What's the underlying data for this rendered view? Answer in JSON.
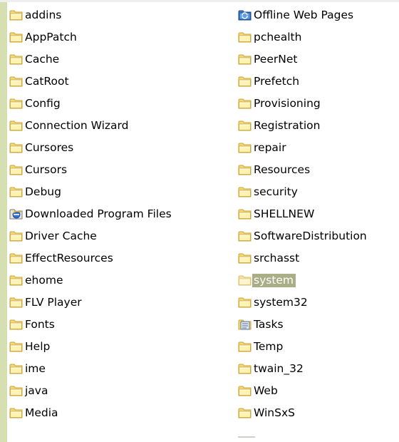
{
  "window": {
    "accent_strip_color": "#d6dfb2",
    "selection_color": "#a9ae86",
    "folder_color": "#f5d774"
  },
  "left_column": [
    {
      "label": "addins",
      "icon": "folder-icon"
    },
    {
      "label": "AppPatch",
      "icon": "folder-icon"
    },
    {
      "label": "Cache",
      "icon": "folder-icon"
    },
    {
      "label": "CatRoot",
      "icon": "folder-icon"
    },
    {
      "label": "Config",
      "icon": "folder-icon"
    },
    {
      "label": "Connection Wizard",
      "icon": "folder-icon"
    },
    {
      "label": "Cursores",
      "icon": "folder-icon"
    },
    {
      "label": "Cursors",
      "icon": "folder-icon"
    },
    {
      "label": "Debug",
      "icon": "folder-icon"
    },
    {
      "label": "Downloaded Program Files",
      "icon": "ie-folder-icon"
    },
    {
      "label": "Driver Cache",
      "icon": "folder-icon"
    },
    {
      "label": "EffectResources",
      "icon": "folder-icon"
    },
    {
      "label": "ehome",
      "icon": "folder-icon"
    },
    {
      "label": "FLV Player",
      "icon": "folder-icon"
    },
    {
      "label": "Fonts",
      "icon": "folder-icon"
    },
    {
      "label": "Help",
      "icon": "folder-icon"
    },
    {
      "label": "ime",
      "icon": "folder-icon"
    },
    {
      "label": "java",
      "icon": "folder-icon"
    },
    {
      "label": "Media",
      "icon": "folder-icon"
    }
  ],
  "right_column": [
    {
      "label": "Offline Web Pages",
      "icon": "offline-pages-icon"
    },
    {
      "label": "pchealth",
      "icon": "folder-icon"
    },
    {
      "label": "PeerNet",
      "icon": "folder-icon"
    },
    {
      "label": "Prefetch",
      "icon": "folder-icon"
    },
    {
      "label": "Provisioning",
      "icon": "folder-icon"
    },
    {
      "label": "Registration",
      "icon": "folder-icon"
    },
    {
      "label": "repair",
      "icon": "folder-icon"
    },
    {
      "label": "Resources",
      "icon": "folder-icon"
    },
    {
      "label": "security",
      "icon": "folder-icon"
    },
    {
      "label": "SHELLNEW",
      "icon": "folder-icon"
    },
    {
      "label": "SoftwareDistribution",
      "icon": "folder-icon"
    },
    {
      "label": "srchasst",
      "icon": "folder-icon"
    },
    {
      "label": "system",
      "icon": "folder-icon",
      "selected": true
    },
    {
      "label": "system32",
      "icon": "folder-icon"
    },
    {
      "label": "Tasks",
      "icon": "tasks-folder-icon"
    },
    {
      "label": "Temp",
      "icon": "folder-icon"
    },
    {
      "label": "twain_32",
      "icon": "folder-icon"
    },
    {
      "label": "Web",
      "icon": "folder-icon"
    },
    {
      "label": "WinSxS",
      "icon": "folder-icon"
    }
  ]
}
